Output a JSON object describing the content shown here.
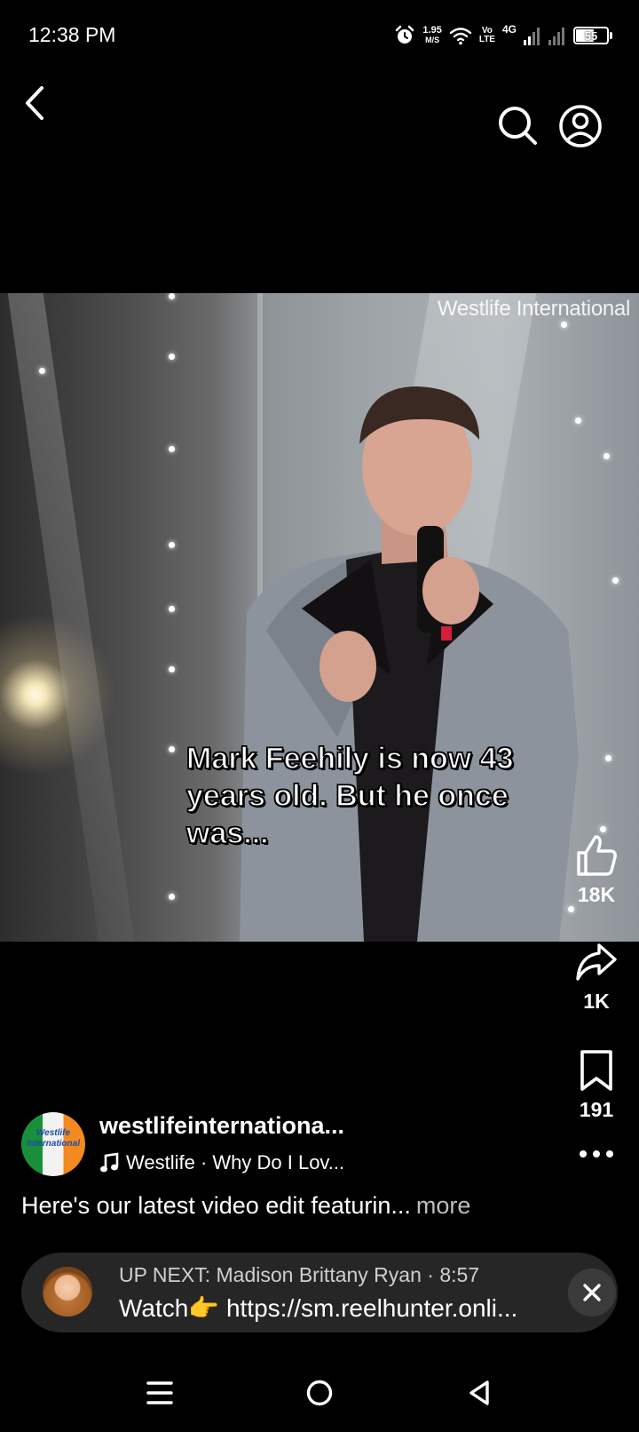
{
  "status_bar": {
    "time": "12:38 PM",
    "net_speed_value": "1.95",
    "net_speed_unit": "M/S",
    "volte_top": "Vo",
    "volte_bottom": "LTE",
    "network_type": "4G",
    "battery_level": "55"
  },
  "video": {
    "watermark": "Westlife International",
    "caption": "Mark Feehily is now 43 years old. But he once was..."
  },
  "actions": {
    "like_count": "18K",
    "share_count": "1K",
    "save_count": "191"
  },
  "channel": {
    "name": "westlifeinternationa...",
    "avatar_text": "Westlife International",
    "music": "Westlife · Why Do I Lov...",
    "description": "Here's our latest video edit featurin...",
    "more_label": "more"
  },
  "up_next": {
    "title": "UP NEXT: Madison Brittany Ryan · 8:57",
    "subtitle": "Watch👉 https://sm.reelhunter.onli..."
  },
  "icons": {
    "back": "chevron-left-icon",
    "search": "search-icon",
    "account": "account-circle-icon",
    "like": "thumbs-up-icon",
    "share": "share-arrow-icon",
    "save": "bookmark-icon",
    "more": "more-horizontal-icon",
    "close": "close-icon",
    "music": "music-note-icon"
  }
}
